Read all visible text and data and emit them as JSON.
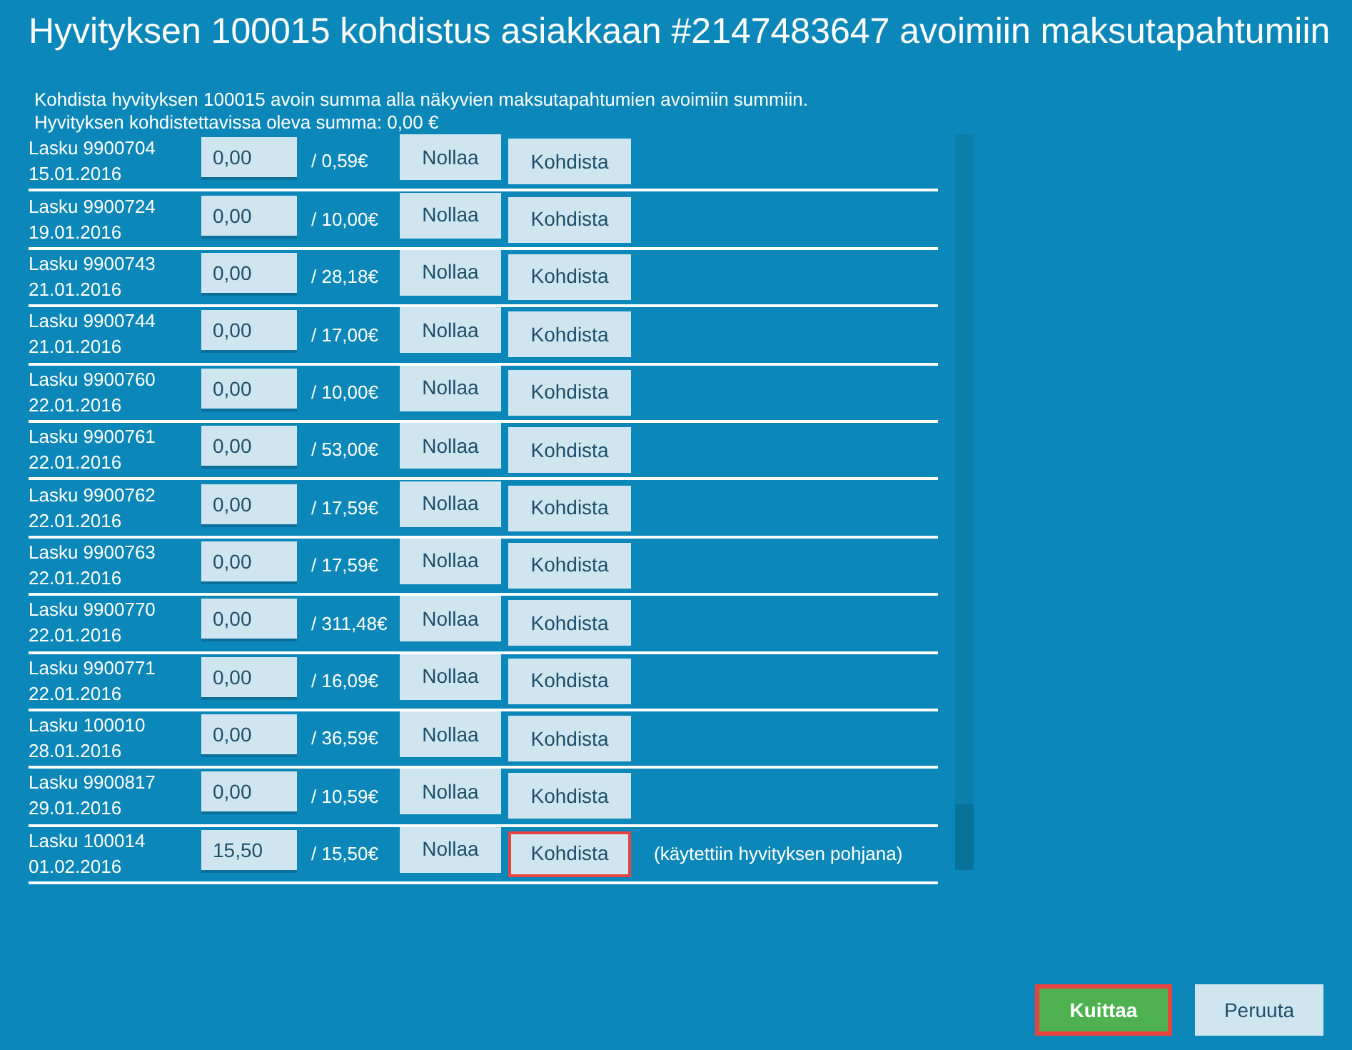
{
  "title": "Hyvityksen 100015 kohdistus asiakkaan #2147483647 avoimiin maksutapahtumiin",
  "intro": "Kohdista hyvityksen 100015 avoin summa alla näkyvien maksutapahtumien avoimiin summiin.",
  "available": "Hyvityksen kohdistettavissa oleva summa: 0,00 €",
  "rows": [
    {
      "invoice": "Lasku 9900704",
      "date": "15.01.2016",
      "amount": "0,00",
      "total": "/ 0,59€",
      "reset": "Nollaa",
      "apply": "Kohdista",
      "focused": false
    },
    {
      "invoice": "Lasku 9900724",
      "date": "19.01.2016",
      "amount": "0,00",
      "total": "/ 10,00€",
      "reset": "Nollaa",
      "apply": "Kohdista",
      "focused": false
    },
    {
      "invoice": "Lasku 9900743",
      "date": "21.01.2016",
      "amount": "0,00",
      "total": "/ 28,18€",
      "reset": "Nollaa",
      "apply": "Kohdista",
      "focused": false
    },
    {
      "invoice": "Lasku 9900744",
      "date": "21.01.2016",
      "amount": "0,00",
      "total": "/ 17,00€",
      "reset": "Nollaa",
      "apply": "Kohdista",
      "focused": false
    },
    {
      "invoice": "Lasku 9900760",
      "date": "22.01.2016",
      "amount": "0,00",
      "total": "/ 10,00€",
      "reset": "Nollaa",
      "apply": "Kohdista",
      "focused": false
    },
    {
      "invoice": "Lasku 9900761",
      "date": "22.01.2016",
      "amount": "0,00",
      "total": "/ 53,00€",
      "reset": "Nollaa",
      "apply": "Kohdista",
      "focused": false
    },
    {
      "invoice": "Lasku 9900762",
      "date": "22.01.2016",
      "amount": "0,00",
      "total": "/ 17,59€",
      "reset": "Nollaa",
      "apply": "Kohdista",
      "focused": false
    },
    {
      "invoice": "Lasku 9900763",
      "date": "22.01.2016",
      "amount": "0,00",
      "total": "/ 17,59€",
      "reset": "Nollaa",
      "apply": "Kohdista",
      "focused": false
    },
    {
      "invoice": "Lasku 9900770",
      "date": "22.01.2016",
      "amount": "0,00",
      "total": "/ 311,48€",
      "reset": "Nollaa",
      "apply": "Kohdista",
      "focused": false
    },
    {
      "invoice": "Lasku 9900771",
      "date": "22.01.2016",
      "amount": "0,00",
      "total": "/ 16,09€",
      "reset": "Nollaa",
      "apply": "Kohdista",
      "focused": false
    },
    {
      "invoice": "Lasku 100010",
      "date": "28.01.2016",
      "amount": "0,00",
      "total": "/ 36,59€",
      "reset": "Nollaa",
      "apply": "Kohdista",
      "focused": false
    },
    {
      "invoice": "Lasku 9900817",
      "date": "29.01.2016",
      "amount": "0,00",
      "total": "/ 10,59€",
      "reset": "Nollaa",
      "apply": "Kohdista",
      "focused": false
    },
    {
      "invoice": "Lasku 100014",
      "date": "01.02.2016",
      "amount": "15,50",
      "total": "/ 15,50€",
      "reset": "Nollaa",
      "apply": "Kohdista",
      "focused": true,
      "note": "(käytettiin hyvityksen pohjana)"
    }
  ],
  "buttons": [
    {
      "label": "Kuittaa",
      "kind": "primary",
      "focused": true
    },
    {
      "label": "Peruuta",
      "kind": "secondary",
      "focused": false
    }
  ]
}
